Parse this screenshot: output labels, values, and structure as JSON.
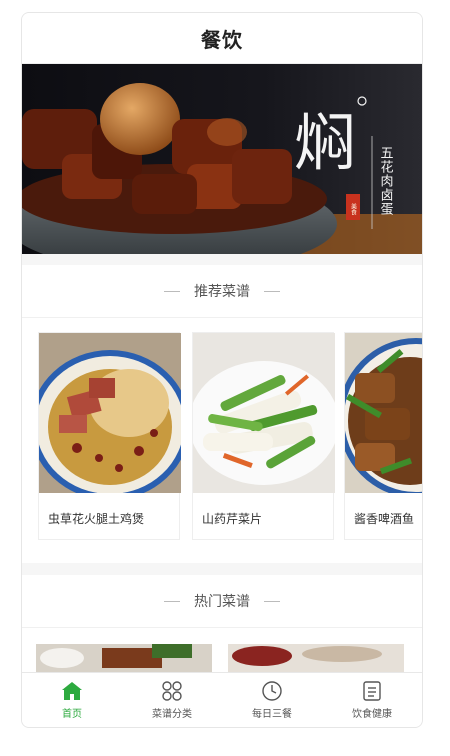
{
  "header": {
    "title": "餐饮"
  },
  "banner": {
    "big_char": "焖",
    "vertical_text": "五花肉卤蛋",
    "seal_text": "美食"
  },
  "recommended": {
    "title": "推荐菜谱",
    "items": [
      {
        "name": "虫草花火腿土鸡煲"
      },
      {
        "name": "山药芹菜片"
      },
      {
        "name": "酱香啤酒鱼"
      }
    ]
  },
  "hot": {
    "title": "热门菜谱"
  },
  "tabbar": {
    "items": [
      {
        "label": "首页",
        "icon": "home-icon",
        "active": true
      },
      {
        "label": "菜谱分类",
        "icon": "grid-icon",
        "active": false
      },
      {
        "label": "每日三餐",
        "icon": "clock-icon",
        "active": false
      },
      {
        "label": "饮食健康",
        "icon": "document-icon",
        "active": false
      }
    ]
  },
  "colors": {
    "accent": "#2daa3f"
  }
}
